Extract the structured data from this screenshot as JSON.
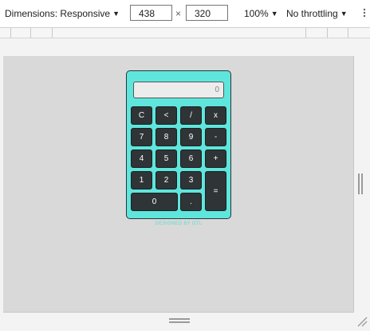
{
  "toolbar": {
    "dimensions_label": "Dimensions: Responsive",
    "width_value": "438",
    "height_value": "320",
    "times": "×",
    "zoom": "100%",
    "throttling": "No throttling",
    "caret": "▼"
  },
  "calculator": {
    "display": "0",
    "keys": {
      "clear": "C",
      "back": "<",
      "divide": "/",
      "multiply": "x",
      "k7": "7",
      "k8": "8",
      "k9": "9",
      "minus": "-",
      "k4": "4",
      "k5": "5",
      "k6": "6",
      "plus": "+",
      "k1": "1",
      "k2": "2",
      "k3": "3",
      "equals": "=",
      "k0": "0",
      "dot": "."
    },
    "credit": "DESIGNED BY GTL",
    "accent_color": "#5fe6dc",
    "key_color": "#2f3437"
  },
  "icons": {
    "more": "more-vertical-icon",
    "resize": "resize-grip-icon"
  }
}
